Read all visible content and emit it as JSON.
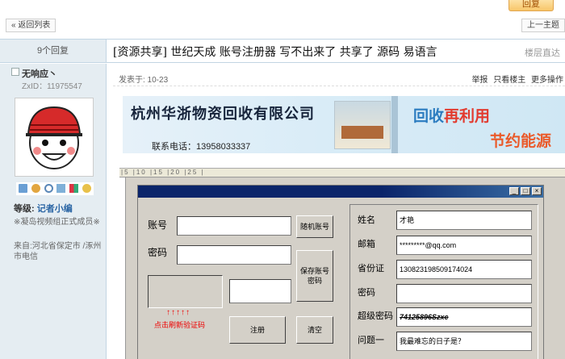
{
  "top": {
    "reply_label": "回复"
  },
  "nav": {
    "back_label": "« 返回列表",
    "prev_label": "上一主题"
  },
  "thread": {
    "reply_count": "9个回复",
    "title": "[资源共享] 世纪天成 账号注册器  写不出来了   共享了   源码   易语言",
    "floor_link": "楼层直达"
  },
  "author": {
    "name": "无响应丶",
    "uid": "ZxID：11975547",
    "level_label": "等级: ",
    "level_value": "记者小编",
    "member_note": "※凝岛视频组正式成员※",
    "origin": "来自:河北省保定市 /涿州市电信",
    "icons": [
      "mail-icon",
      "user-add-icon",
      "search-icon",
      "profile-icon",
      "group-icon",
      "award-icon"
    ]
  },
  "post": {
    "posted_at": "发表于: 10-23",
    "actions": [
      "举报",
      "只看楼主",
      "更多操作"
    ]
  },
  "banner": {
    "company": "杭州华浙物资回收有限公司",
    "phone": "联系电话：13958033337",
    "slogan_blue": "回收",
    "slogan_red": "再利用",
    "slogan_energy": "节约能源"
  },
  "app": {
    "ruler_text": "|5 |10 |15 |20 |25 |",
    "labels": {
      "account": "账号",
      "password": "密码",
      "name": "姓名",
      "email": "邮箱",
      "id_card": "省份证",
      "pwd2": "密码",
      "super_pwd": "超级密码",
      "question1": "问题一"
    },
    "values": {
      "account": "",
      "password": "",
      "captcha_input": "",
      "name": "才艳",
      "email": "*********@qq.com",
      "id_card": "130823198509174024",
      "pwd2": "",
      "super_pwd": "74125896Szxc",
      "question1": "我最难忘的日子是？"
    },
    "buttons": {
      "random_account": "随机账号",
      "save_account": "保存账号\n密码",
      "register": "注册",
      "clear": "清空"
    },
    "arrows": "↑↑↑↑↑",
    "hint": "点击刷新验证码"
  },
  "colors": {
    "accent": "#2a65a4",
    "header_bg": "#e5edf2",
    "titlebar": "#0a246a"
  }
}
